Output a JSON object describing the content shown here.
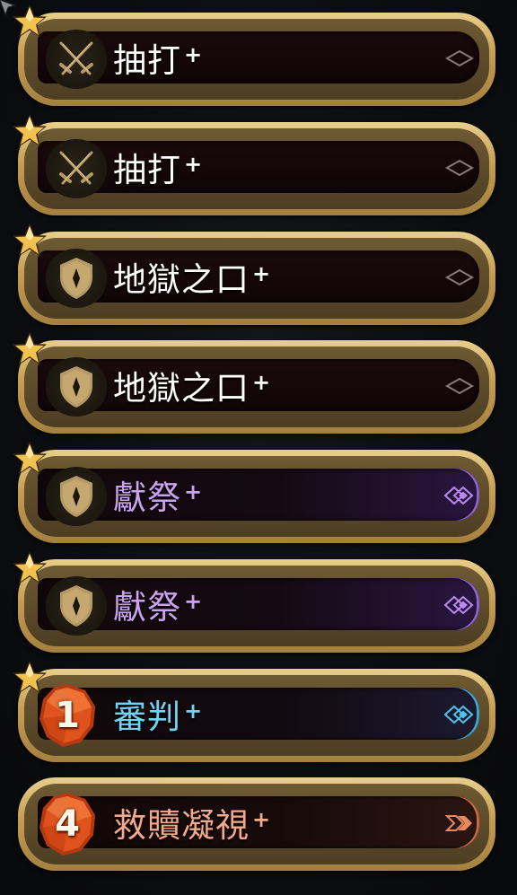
{
  "cards": [
    {
      "name": "抽打",
      "plus": "+",
      "upgraded": true,
      "type": "attack",
      "cost": null,
      "rarity": "common"
    },
    {
      "name": "抽打",
      "plus": "+",
      "upgraded": true,
      "type": "attack",
      "cost": null,
      "rarity": "common"
    },
    {
      "name": "地獄之口",
      "plus": "+",
      "upgraded": true,
      "type": "skill",
      "cost": null,
      "rarity": "common"
    },
    {
      "name": "地獄之口",
      "plus": "+",
      "upgraded": true,
      "type": "skill",
      "cost": null,
      "rarity": "common"
    },
    {
      "name": "獻祭",
      "plus": "+",
      "upgraded": true,
      "type": "skill",
      "cost": null,
      "rarity": "epic"
    },
    {
      "name": "獻祭",
      "plus": "+",
      "upgraded": true,
      "type": "skill",
      "cost": null,
      "rarity": "epic"
    },
    {
      "name": "審判",
      "plus": "+",
      "upgraded": true,
      "type": "cost",
      "cost": "1",
      "rarity": "rare"
    },
    {
      "name": "救贖凝視",
      "plus": "+",
      "upgraded": false,
      "type": "cost",
      "cost": "4",
      "rarity": "legendary"
    }
  ],
  "colors": {
    "gold_frame": "#c49d52",
    "common_text": "#ffffff",
    "epic_text": "#c9a3f0",
    "rare_text": "#6fd3f3",
    "legendary_text": "#f3a98a",
    "star": "#f2c250",
    "cost_gem": "#e0531f"
  },
  "icons": {
    "attack": "crossed-swords-icon",
    "skill": "shield-icon",
    "cost": "cost-gem-icon",
    "upgrade": "star-icon",
    "rarity_common": "rarity-common-icon",
    "rarity_epic": "rarity-epic-icon",
    "rarity_rare": "rarity-rare-icon",
    "rarity_legendary": "rarity-legendary-icon"
  }
}
